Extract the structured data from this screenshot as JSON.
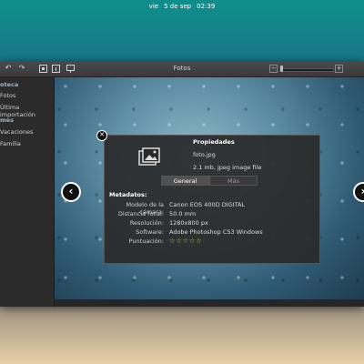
{
  "topbar": {
    "day": "vie",
    "date": "5 de sep",
    "time": "02:39"
  },
  "window": {
    "title": "Fotos"
  },
  "sidebar": {
    "sections": [
      {
        "heading": "oteca",
        "items": [
          "Fotos",
          "Última importación"
        ]
      },
      {
        "heading": "mes",
        "items": [
          "Vacaciones",
          "Familia"
        ]
      }
    ]
  },
  "dialog": {
    "title": "Propiedades",
    "filename": "foto.jpg",
    "size": "2.1 mb, jpeg image file",
    "tabs": {
      "general": "General",
      "more": "Más"
    },
    "metadata_heading": "Metadatos:",
    "fields": [
      {
        "label": "Modelo de la cámara:",
        "value": "Canon EOS 400D DIGITAL"
      },
      {
        "label": "Distancia focal:",
        "value": "50.0 mm"
      },
      {
        "label": "Resolución:",
        "value": "1280x800 px"
      },
      {
        "label": "Software:",
        "value": "Adobe Photoshop CS3 Windows"
      },
      {
        "label": "Puntuación:",
        "value": ""
      }
    ],
    "rating": {
      "stars": 0,
      "max": 5
    }
  },
  "colors": {
    "accent": "#c9c04a",
    "window_bg": "#2d2d2d"
  }
}
